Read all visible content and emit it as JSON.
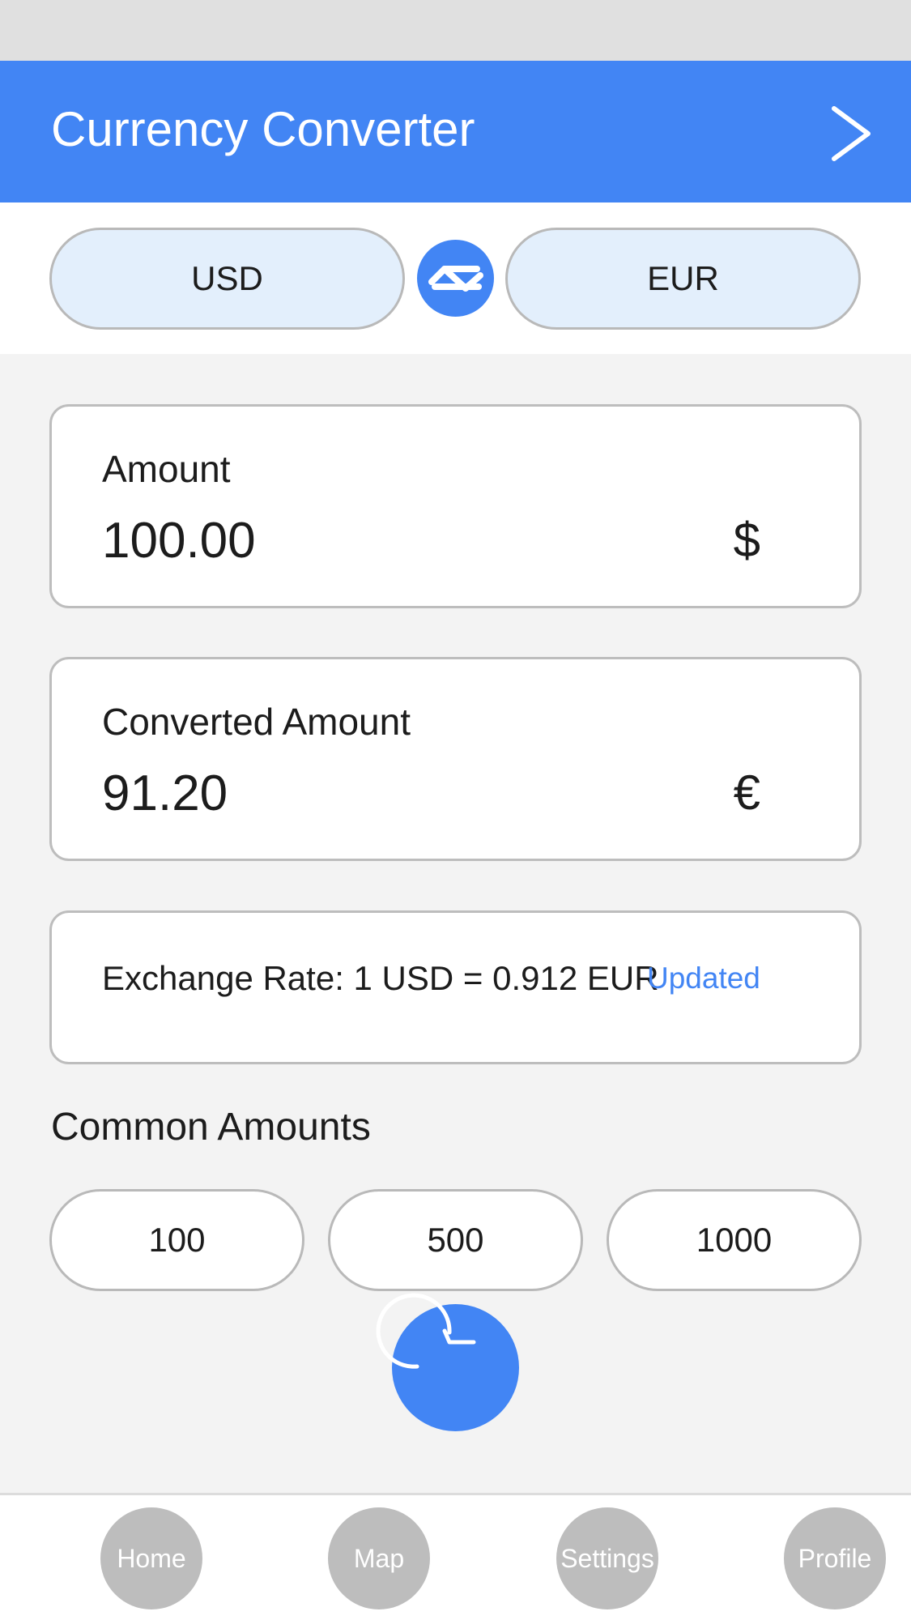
{
  "app_bar": {
    "title": "Currency Converter",
    "action_icon": "chevron-right-icon"
  },
  "currency_selector": {
    "from": "USD",
    "to": "EUR",
    "swap_icon": "swap-arrows-icon"
  },
  "amount": {
    "label": "Amount",
    "value": "100.00",
    "symbol": "$"
  },
  "converted": {
    "label": "Converted Amount",
    "value": "91.20",
    "symbol": "€"
  },
  "rate": {
    "text": "Exchange Rate: 1 USD = 0.912 EUR",
    "status": "Updated"
  },
  "common_amounts": {
    "title": "Common Amounts",
    "options": [
      "100",
      "500",
      "1000"
    ]
  },
  "fab": {
    "icon": "refresh-icon"
  },
  "nav": {
    "items": [
      "Home",
      "Map",
      "Settings",
      "Profile"
    ]
  },
  "colors": {
    "primary": "#4285f4",
    "pill_bg": "#e3effc",
    "background": "#f3f3f3",
    "nav_item": "#bdbdbd"
  }
}
